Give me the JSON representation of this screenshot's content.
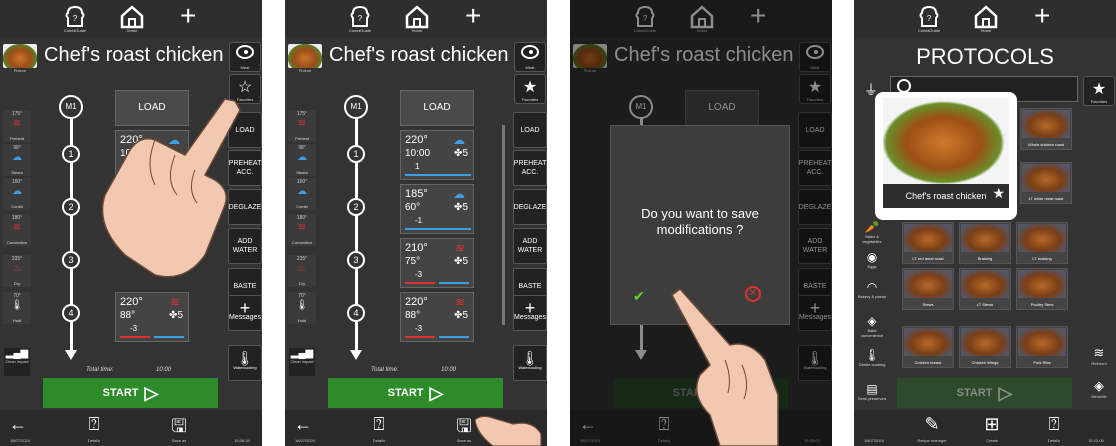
{
  "topbar": {
    "combiguide_label": "CombiGuide",
    "home_label": "Home"
  },
  "recipe": {
    "title": "Chef's roast chicken",
    "picture_label": "Picture",
    "meat_label": "Meat",
    "favorites_label": "Favorites",
    "load_label": "LOAD",
    "total_time_label": "Total time:",
    "total_time_value": "10:00"
  },
  "left_modes": [
    {
      "value": "175°",
      "label": "Preheat",
      "icon": "preheat-icon"
    },
    {
      "value": "98°",
      "label": "Steam",
      "icon": "steam-icon"
    },
    {
      "value": "160°",
      "label": "Combi",
      "icon": "combi-icon"
    },
    {
      "value": "180°",
      "label": "Convection",
      "icon": "convection-icon"
    },
    {
      "value": "235°",
      "label": "Dry",
      "icon": "dry-icon"
    },
    {
      "value": "70°",
      "label": "Hold",
      "icon": "hold-icon"
    }
  ],
  "steps": [
    {
      "num": "1",
      "temp": "220°",
      "time": "10:00",
      "delta": "1",
      "fan": "5",
      "mode": "steam"
    },
    {
      "num": "2",
      "temp": "185°",
      "time": "60°",
      "delta": "-1",
      "fan": "5",
      "mode": "combi"
    },
    {
      "num": "3",
      "temp": "210°",
      "time": "75°",
      "delta": "-3",
      "fan": "5",
      "mode": "convection"
    },
    {
      "num": "4",
      "temp": "220°",
      "time": "88°",
      "delta": "-3",
      "fan": "5",
      "mode": "convection"
    }
  ],
  "right_buttons": {
    "load": "LOAD",
    "preheat": "PREHEAT ACC.",
    "deglaze": "DEGLAZE",
    "add_water": "ADD WATER",
    "baste": "BASTE",
    "messages": "Messages",
    "watercooling": "Watercooling"
  },
  "bottom": {
    "clean_impact": "Clean impact",
    "start": "START",
    "details": "Details",
    "save_as": "Save as",
    "date": "18/07/2024",
    "time_p1": "15:08:34",
    "time_p2": "15:25:29",
    "time_p3": "15:26:03"
  },
  "dialog": {
    "message_line1": "Do you want to save",
    "message_line2": "modifications ?"
  },
  "protocols": {
    "title": "PROTOCOLS",
    "featured": "Chef's roast chicken",
    "favorites_label": "Favorites",
    "categories": [
      {
        "label": "Sides & vegetables"
      },
      {
        "label": "Eggs"
      },
      {
        "label": "Bakery & pastry"
      },
      {
        "label": "Bake convenience"
      },
      {
        "label": "Gentle cooking"
      },
      {
        "label": "Semi preserved"
      }
    ],
    "tiles": [
      "Whole chicken roast",
      "LT white meat roast",
      "LT red meat roast",
      "Braising",
      "LT braising",
      "Stews",
      "LT Stews",
      "Poultry Stew",
      "Chicken breast",
      "Chicken Wings",
      "Pork Ribs"
    ],
    "right_labels": {
      "rethermalization": "Retherm",
      "menuvite": "MenuMe"
    },
    "bottom": {
      "recipe_manager": "Recipe manager",
      "create": "Create",
      "details": "Details",
      "date": "18/07/2024",
      "time": "15:12:00"
    }
  },
  "colors": {
    "panel_bg": "#333333",
    "start_green": "#2e8b2a",
    "confirm_green": "#6ecc2e",
    "cancel_red": "#e03030",
    "bar_blue": "#3aa0e0"
  }
}
